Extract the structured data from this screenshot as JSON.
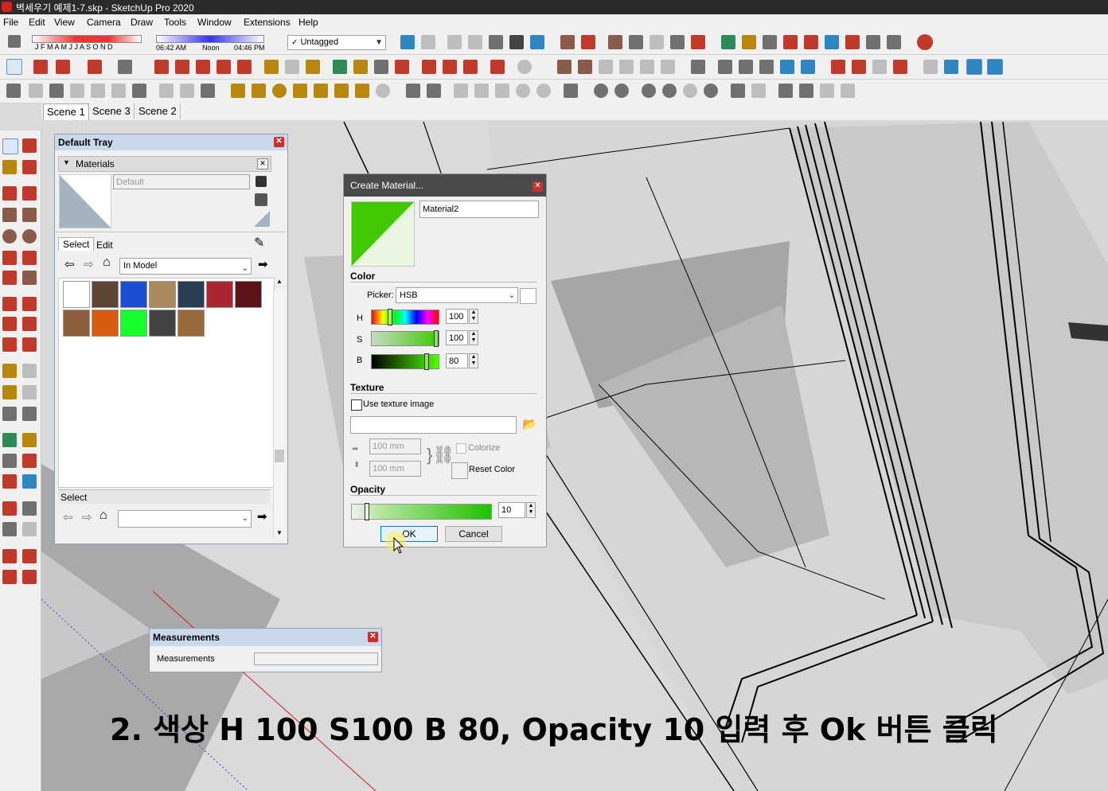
{
  "window": {
    "title": "벽세우기 예제1-7.skp - SketchUp Pro 2020"
  },
  "menu": [
    "File",
    "Edit",
    "View",
    "Camera",
    "Draw",
    "Tools",
    "Window",
    "Extensions",
    "Help"
  ],
  "toolbar": {
    "shadow_months": "J F M A M J J A S O N D",
    "time_start": "06:42 AM",
    "time_noon": "Noon",
    "time_end": "04:46 PM",
    "tag_value": "Untagged"
  },
  "scenes": [
    {
      "label": "Scene 1",
      "active": true
    },
    {
      "label": "Scene 3",
      "active": false
    },
    {
      "label": "Scene 2",
      "active": false
    }
  ],
  "tray": {
    "title": "Default Tray",
    "section": "Materials",
    "current_material": "Default",
    "tabs": [
      "Select",
      "Edit"
    ],
    "collection": "In Model",
    "swatch_colors": [
      "#ffffff",
      "#5d4636",
      "#1a4fd1",
      "#a88a5e",
      "#2b3d52",
      "#a8262e",
      "#5c1418",
      "#8b5e3c",
      "#d95b10",
      "#14ff2c",
      "#424242",
      "#9b6a3c"
    ],
    "lower_label": "Select"
  },
  "create_material": {
    "title": "Create Material...",
    "name": "Material2",
    "color_label": "Color",
    "picker_label": "Picker:",
    "picker_value": "HSB",
    "h_label": "H",
    "h_value": "100",
    "s_label": "S",
    "s_value": "100",
    "b_label": "B",
    "b_value": "80",
    "preview_color": "#40c800",
    "texture_label": "Texture",
    "use_texture_label": "Use texture image",
    "width_value": "100 mm",
    "height_value": "100 mm",
    "colorize_label": "Colorize",
    "reset_color_label": "Reset Color",
    "opacity_label": "Opacity",
    "opacity_value": "10",
    "ok_label": "OK",
    "cancel_label": "Cancel"
  },
  "measurements": {
    "title": "Measurements",
    "label": "Measurements",
    "value": ""
  },
  "caption": "2. 색상 H 100  S100 B 80, Opacity 10 입력 후 Ok 버튼 클릭"
}
